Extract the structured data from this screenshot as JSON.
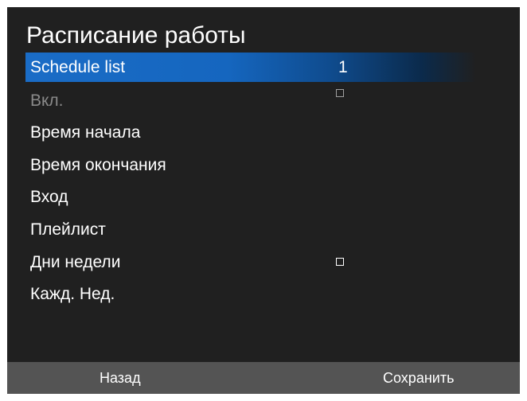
{
  "screen": {
    "title": "Расписание работы",
    "accent_color": "#1a6cc6",
    "background_color": "#202020"
  },
  "menu": {
    "schedule_list_label": "Schedule list",
    "schedule_list_value": "1",
    "enable_label": "Вкл.",
    "enable_checked": false,
    "start_time_label": "Время начала",
    "end_time_label": "Время окончания",
    "input_label": "Вход",
    "playlist_label": "Плейлист",
    "weekdays_label": "Дни недели",
    "weekdays_checked": false,
    "every_week_label": "Кажд. Нед."
  },
  "footer": {
    "back_label": "Назад",
    "save_label": "Сохранить"
  }
}
